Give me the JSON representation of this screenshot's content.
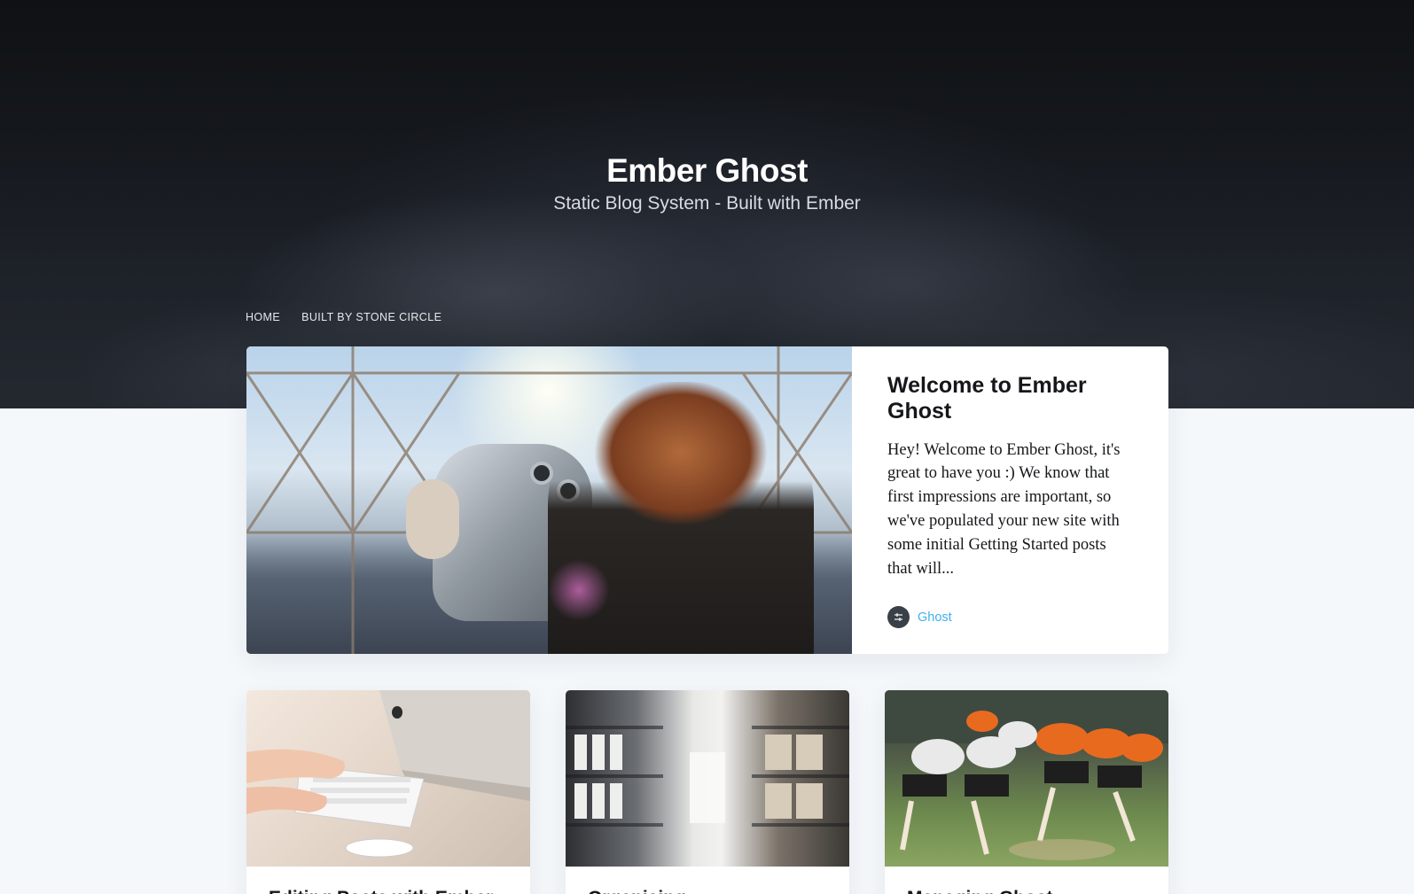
{
  "site": {
    "title": "Ember Ghost",
    "description": "Static Blog System - Built with Ember"
  },
  "nav": {
    "items": [
      {
        "label": "HOME"
      },
      {
        "label": "BUILT BY STONE CIRCLE"
      }
    ]
  },
  "featured": {
    "title": "Welcome to Ember Ghost",
    "excerpt": "Hey! Welcome to Ember Ghost, it's great to have you :) We know that first impressions are important, so we've populated your new site with some initial Getting Started posts that will...",
    "tag": "Ghost",
    "tag_icon": "ghost-icon"
  },
  "cards": [
    {
      "title": "Editing Posts with Ember"
    },
    {
      "title": "Organising"
    },
    {
      "title": "Managing Ghost"
    }
  ],
  "colors": {
    "accent": "#3eb0ef",
    "text": "#15171a",
    "background": "#f4f8fb"
  }
}
